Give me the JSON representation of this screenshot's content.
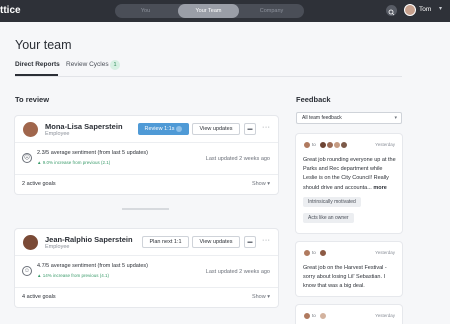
{
  "app": {
    "logo": "ttice"
  },
  "nav": {
    "segments": [
      {
        "label": "You",
        "active": false
      },
      {
        "label": "Your Team",
        "active": true
      },
      {
        "label": "Company",
        "active": false
      }
    ],
    "search_icon": "search-icon",
    "user_name": "Tom"
  },
  "page": {
    "title": "Your team",
    "tabs": [
      {
        "label": "Direct Reports",
        "active": true
      },
      {
        "label": "Review Cycles",
        "count": "1"
      }
    ]
  },
  "review": {
    "title": "To review",
    "cards": [
      {
        "name": "Mona-Lisa Saperstein",
        "role": "Employee",
        "primary_action": "Review 1:1s",
        "primary_style": "primary",
        "secondary_action": "View updates",
        "sentiment": "2.3/5 average sentiment (from last 5 updates)",
        "sentiment_change": "▲ 9.0% increase from previous (2.1)",
        "last_updated": "Last updated 2 weeks ago",
        "goals": "2 active goals",
        "show_label": "Show"
      },
      {
        "name": "Jean-Ralphio Saperstein",
        "role": "Employee",
        "primary_action": "Plan next 1:1",
        "primary_style": "outline",
        "secondary_action": "View updates",
        "sentiment": "4.7/5 average sentiment (from last 5 updates)",
        "sentiment_change": "▲ 14% increase from previous (4.1)",
        "last_updated": "Last updated 2 weeks ago",
        "goals": "4 active goals",
        "show_label": "Show"
      }
    ]
  },
  "feedback": {
    "title": "Feedback",
    "filter": "All team feedback",
    "items": [
      {
        "to_label": "to",
        "date": "Yesterday",
        "text": "Great job rounding everyone up at the Parks and Rec department while Leslie is on the City Council! Really should drive and accounta...",
        "more": "more",
        "tags": [
          "Intrinsically motivated",
          "Acts like an owner"
        ]
      },
      {
        "to_label": "to",
        "date": "Yesterday",
        "text": "Great job on the Harvest Festival - sorry about losing Lil' Sebastian. I know that was a big deal."
      },
      {
        "to_label": "to",
        "date": "Yesterday"
      }
    ]
  },
  "colors": {
    "topbar": "#2e3138",
    "accent": "#4f9ad6",
    "positive": "#3a9b6a"
  }
}
